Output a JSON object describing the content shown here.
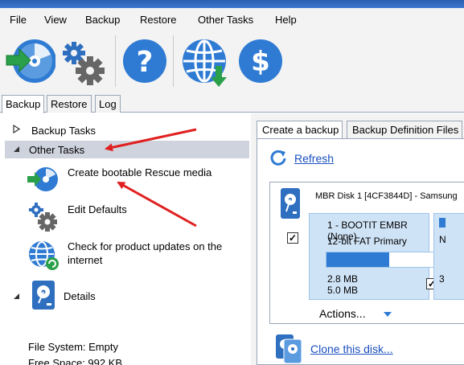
{
  "menu": {
    "items": [
      "File",
      "View",
      "Backup",
      "Restore",
      "Other Tasks",
      "Help"
    ]
  },
  "toolbar": {
    "icons": [
      "backup-disc-icon",
      "settings-gears-icon",
      "help-icon",
      "web-update-icon",
      "dollar-icon"
    ]
  },
  "main_tabs": {
    "backup": "Backup",
    "restore": "Restore",
    "log": "Log"
  },
  "left": {
    "backup_tasks": "Backup Tasks",
    "other_tasks": "Other Tasks",
    "tasks": [
      {
        "label_line1": "Create bootable Rescue media",
        "label_line2": ""
      },
      {
        "label_line1": "Edit Defaults",
        "label_line2": ""
      },
      {
        "label_line1": "Check for product updates on the",
        "label_line2": "internet"
      }
    ],
    "details": "Details",
    "file_system": "File System: Empty",
    "free_space": "Free Space:   992 KB"
  },
  "right": {
    "tab_create": "Create a backup",
    "tab_definition": "Backup Definition Files",
    "refresh": "Refresh",
    "disk_title": "MBR Disk 1 [4CF3844D] - Samsung",
    "partition": {
      "name": "1 - BOOTIT EMBR (None)",
      "type": "12-bit FAT Primary",
      "used": "2.8 MB",
      "total": "5.0 MB",
      "used_fraction": 0.55
    },
    "partition2": {
      "name_fragment": "N",
      "size_fragment": "3"
    },
    "actions": "Actions...",
    "clone": "Clone this disk..."
  },
  "colors": {
    "accent_blue": "#2f7bd3",
    "selection": "#cfd3de",
    "partition_bg": "#cfe3f6",
    "arrow_red": "#e02020",
    "link": "#1a4fbf"
  }
}
